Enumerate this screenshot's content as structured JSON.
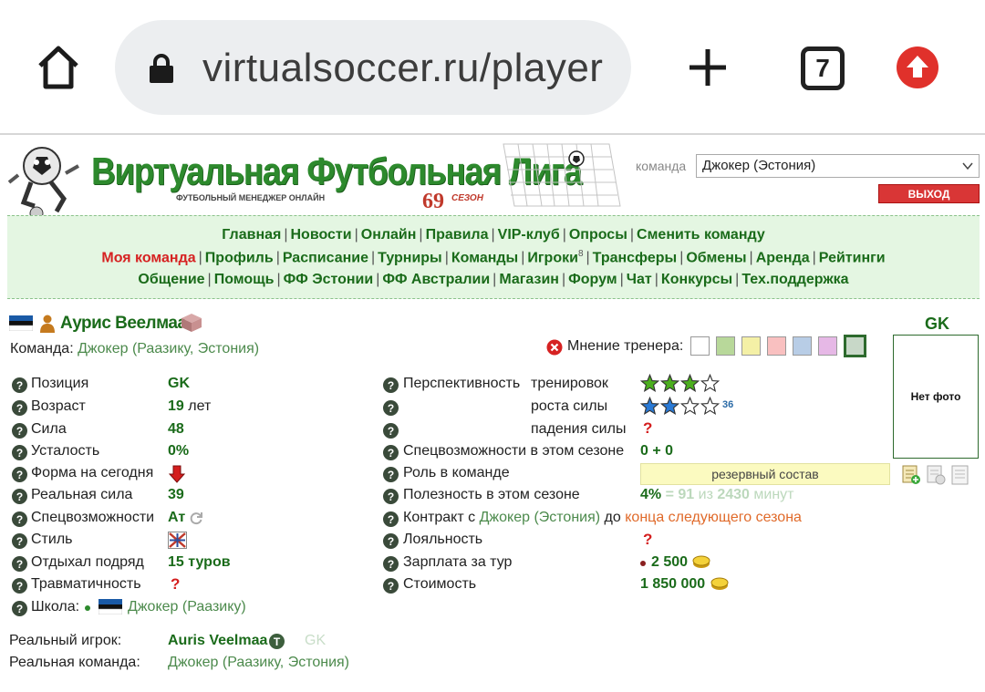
{
  "browser": {
    "url": "virtualsoccer.ru/player",
    "tab_count": "7"
  },
  "site": {
    "logo_title": "Виртуальная Футбольная Лига",
    "logo_subtitle": "ФУТБОЛЬНЫЙ МЕНЕДЖЕР ОНЛАЙН",
    "season_number": "69",
    "season_label": "СЕЗОН",
    "team_label": "команда",
    "team_selected": "Джокер (Эстония)",
    "logout_label": "ВЫХОД"
  },
  "nav": {
    "row0": [
      "Главная",
      "Новости",
      "Онлайн",
      "Правила",
      "VIP-клуб",
      "Опросы",
      "Сменить команду"
    ],
    "row1": [
      "Моя команда",
      "Профиль",
      "Расписание",
      "Турниры",
      "Команды",
      "Игроки",
      "Трансферы",
      "Обмены",
      "Аренда",
      "Рейтинги"
    ],
    "row1_players_badge": "8",
    "row2": [
      "Общение",
      "Помощь",
      "ФФ Эстонии",
      "ФФ Австралии",
      "Магазин",
      "Форум",
      "Чат",
      "Конкурсы",
      "Тех.поддержка"
    ]
  },
  "player": {
    "name": "Аурис Веелмаа",
    "team_label": "Команда:",
    "team_value": "Джокер (Раазику, Эстония)",
    "coach_opinion_label": "Мнение тренера:",
    "position_header": "GK",
    "no_photo": "Нет фото",
    "left": {
      "position_label": "Позиция",
      "position_value": "GK",
      "age_label": "Возраст",
      "age_value": "19",
      "age_unit": "лет",
      "strength_label": "Сила",
      "strength_value": "48",
      "fatigue_label": "Усталость",
      "fatigue_value": "0%",
      "form_label": "Форма на сегодня",
      "real_strength_label": "Реальная сила",
      "real_strength_value": "39",
      "special_label": "Спецвозможности",
      "special_value": "Ат",
      "style_label": "Стиль",
      "rested_label": "Отдыхал подряд",
      "rested_value": "15",
      "rested_unit": "туров",
      "injury_label": "Травматичность",
      "school_label": "Школа:",
      "school_value": "Джокер (Раазику)"
    },
    "right": {
      "perspective_label": "Перспективность",
      "training_label": "тренировок",
      "growth_label": "роста силы",
      "growth_count": "36",
      "decline_label": "падения силы",
      "special_season_label": "Спецвозможности в этом сезоне",
      "special_season_value": "0 + 0",
      "role_label": "Роль в команде",
      "role_value": "резервный состав",
      "usefulness_label": "Полезность в этом сезоне",
      "usefulness_pct": "4%",
      "usefulness_eq": "= 91",
      "usefulness_of": "из",
      "usefulness_total": "2430",
      "usefulness_unit": "минут",
      "contract_label": "Контракт с",
      "contract_team": "Джокер (Эстония)",
      "contract_to": "до",
      "contract_until": "конца следующего сезона",
      "loyalty_label": "Лояльность",
      "salary_label": "Зарплата за тур",
      "salary_value": "2 500",
      "cost_label": "Стоимость",
      "cost_value": "1 850 000"
    },
    "real_player_label": "Реальный игрок:",
    "real_player_value": "Auris Veelmaa",
    "real_player_pos": "GK",
    "real_team_label": "Реальная команда:",
    "real_team_value": "Джокер (Раазику, Эстония)",
    "training_stars": 3,
    "growth_stars": 2
  },
  "colors": {
    "site_green": "#1a6b1a",
    "nav_bg": "#e4f6e2",
    "active_red": "#d62222",
    "swatches": [
      "#ffffff",
      "#b8d89a",
      "#f4f0a6",
      "#f9c0c0",
      "#b8cde6",
      "#e6b8e6",
      "#c8d8c8"
    ]
  },
  "icons": [
    "home-icon",
    "lock-icon",
    "plus-icon",
    "upload-icon",
    "estonia-flag-icon",
    "help-icon",
    "red-arrow-down-icon",
    "refresh-icon",
    "star-icon",
    "coin-icon",
    "close-circle-icon",
    "box-icon"
  ]
}
